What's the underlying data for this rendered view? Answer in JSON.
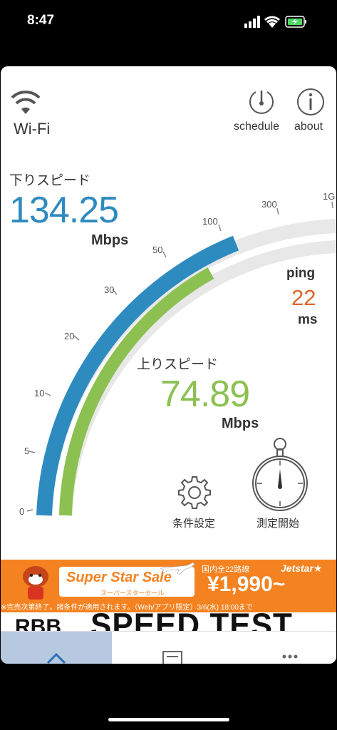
{
  "status_bar": {
    "time": "8:47"
  },
  "header": {
    "network_label": "Wi-Fi",
    "schedule_label": "schedule",
    "about_label": "about"
  },
  "download": {
    "title": "下りスピード",
    "value": "134.25",
    "unit": "Mbps",
    "color": "#2e8bc0"
  },
  "upload": {
    "title": "上りスピード",
    "value": "74.89",
    "unit": "Mbps",
    "color": "#8cc152"
  },
  "ping": {
    "label": "ping",
    "value": "22",
    "unit": "ms",
    "color": "#e0642a"
  },
  "gauge": {
    "ticks": [
      "0",
      "5",
      "10",
      "20",
      "30",
      "50",
      "100",
      "300",
      "1G"
    ]
  },
  "actions": {
    "settings_label": "条件設定",
    "measure_label": "測定開始"
  },
  "ad": {
    "headline": "Super Star Sale",
    "sub": "スーパースターセール",
    "route": "国内全22路線",
    "brand": "Jetstar★",
    "price": "¥1,990~",
    "note": "※完売次第終了。諸条件が適用されます。（Web/アプリ限定）3/6(水) 18:00まで"
  },
  "app_logo": {
    "mark": "RBB",
    "title": "SPEED TEST"
  }
}
